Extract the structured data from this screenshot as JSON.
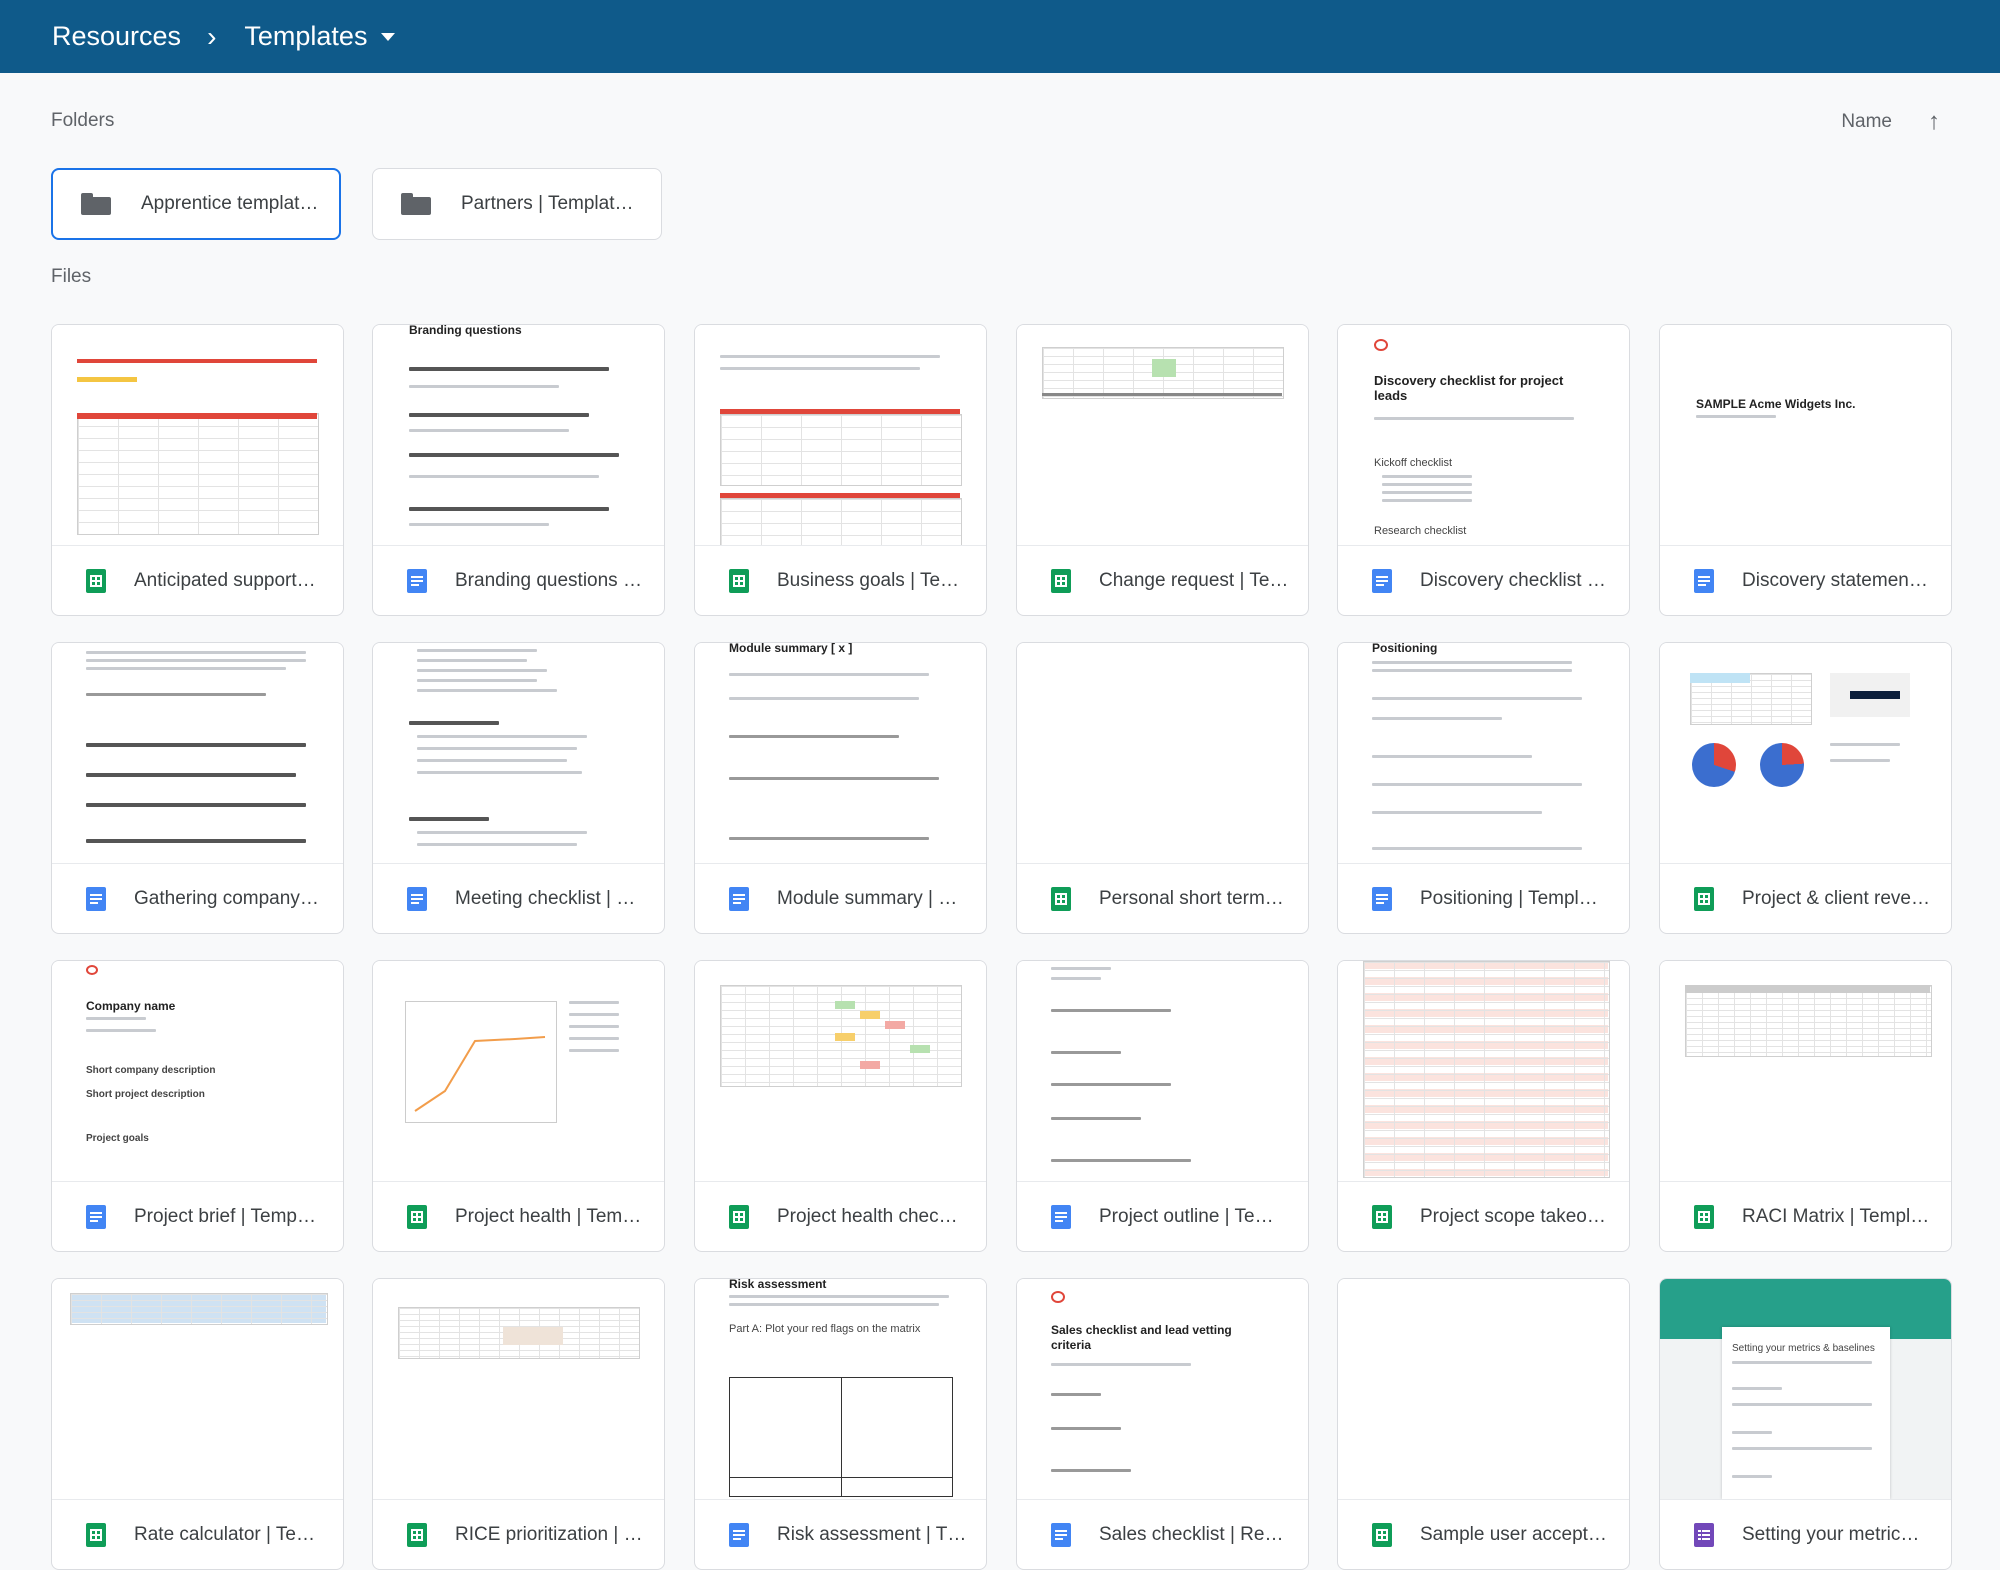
{
  "breadcrumb": {
    "root": "Resources",
    "separator": "›",
    "current": "Templates"
  },
  "folders_label": "Folders",
  "files_label": "Files",
  "sort": {
    "label": "Name",
    "direction_icon": "↑"
  },
  "folders": [
    {
      "name": "Apprentice templat…"
    },
    {
      "name": "Partners | Templat…"
    }
  ],
  "files": [
    {
      "name": "Anticipated support…",
      "type": "sheets"
    },
    {
      "name": "Branding questions …",
      "type": "docs"
    },
    {
      "name": "Business goals | Te…",
      "type": "sheets"
    },
    {
      "name": "Change request | Te…",
      "type": "sheets"
    },
    {
      "name": "Discovery checklist …",
      "type": "docs"
    },
    {
      "name": "Discovery statemen…",
      "type": "docs"
    },
    {
      "name": "Gathering company…",
      "type": "docs"
    },
    {
      "name": "Meeting checklist | …",
      "type": "docs"
    },
    {
      "name": "Module summary | …",
      "type": "docs"
    },
    {
      "name": "Personal short term…",
      "type": "sheets"
    },
    {
      "name": "Positioning | Templ…",
      "type": "docs"
    },
    {
      "name": "Project & client reve…",
      "type": "sheets"
    },
    {
      "name": "Project brief | Temp…",
      "type": "docs"
    },
    {
      "name": "Project health | Tem…",
      "type": "sheets"
    },
    {
      "name": "Project health chec…",
      "type": "sheets"
    },
    {
      "name": "Project outline | Te…",
      "type": "docs"
    },
    {
      "name": "Project scope takeo…",
      "type": "sheets"
    },
    {
      "name": "RACI Matrix | Templ…",
      "type": "sheets"
    },
    {
      "name": "Rate calculator | Te…",
      "type": "sheets"
    },
    {
      "name": "RICE prioritization | …",
      "type": "sheets"
    },
    {
      "name": "Risk assessment | T…",
      "type": "docs"
    },
    {
      "name": "Sales checklist | Re…",
      "type": "docs"
    },
    {
      "name": "Sample user accept…",
      "type": "sheets"
    },
    {
      "name": "Setting your metric…",
      "type": "forms"
    }
  ],
  "thumb_text": {
    "branding": "Branding questions",
    "discovery_checklist": "Discovery checklist for project leads",
    "kickoff": "Kickoff checklist",
    "research": "Research checklist",
    "acme": "SAMPLE Acme Widgets Inc.",
    "module": "Module summary [ x ]",
    "positioning": "Positioning",
    "company_name": "Company name",
    "short_company": "Short company description",
    "short_project": "Short project description",
    "project_goals": "Project goals",
    "risk": "Risk assessment",
    "risk_part": "Part A: Plot your red flags on the matrix",
    "sales": "Sales checklist and lead vetting criteria",
    "metrics": "Setting your metrics & baselines"
  }
}
